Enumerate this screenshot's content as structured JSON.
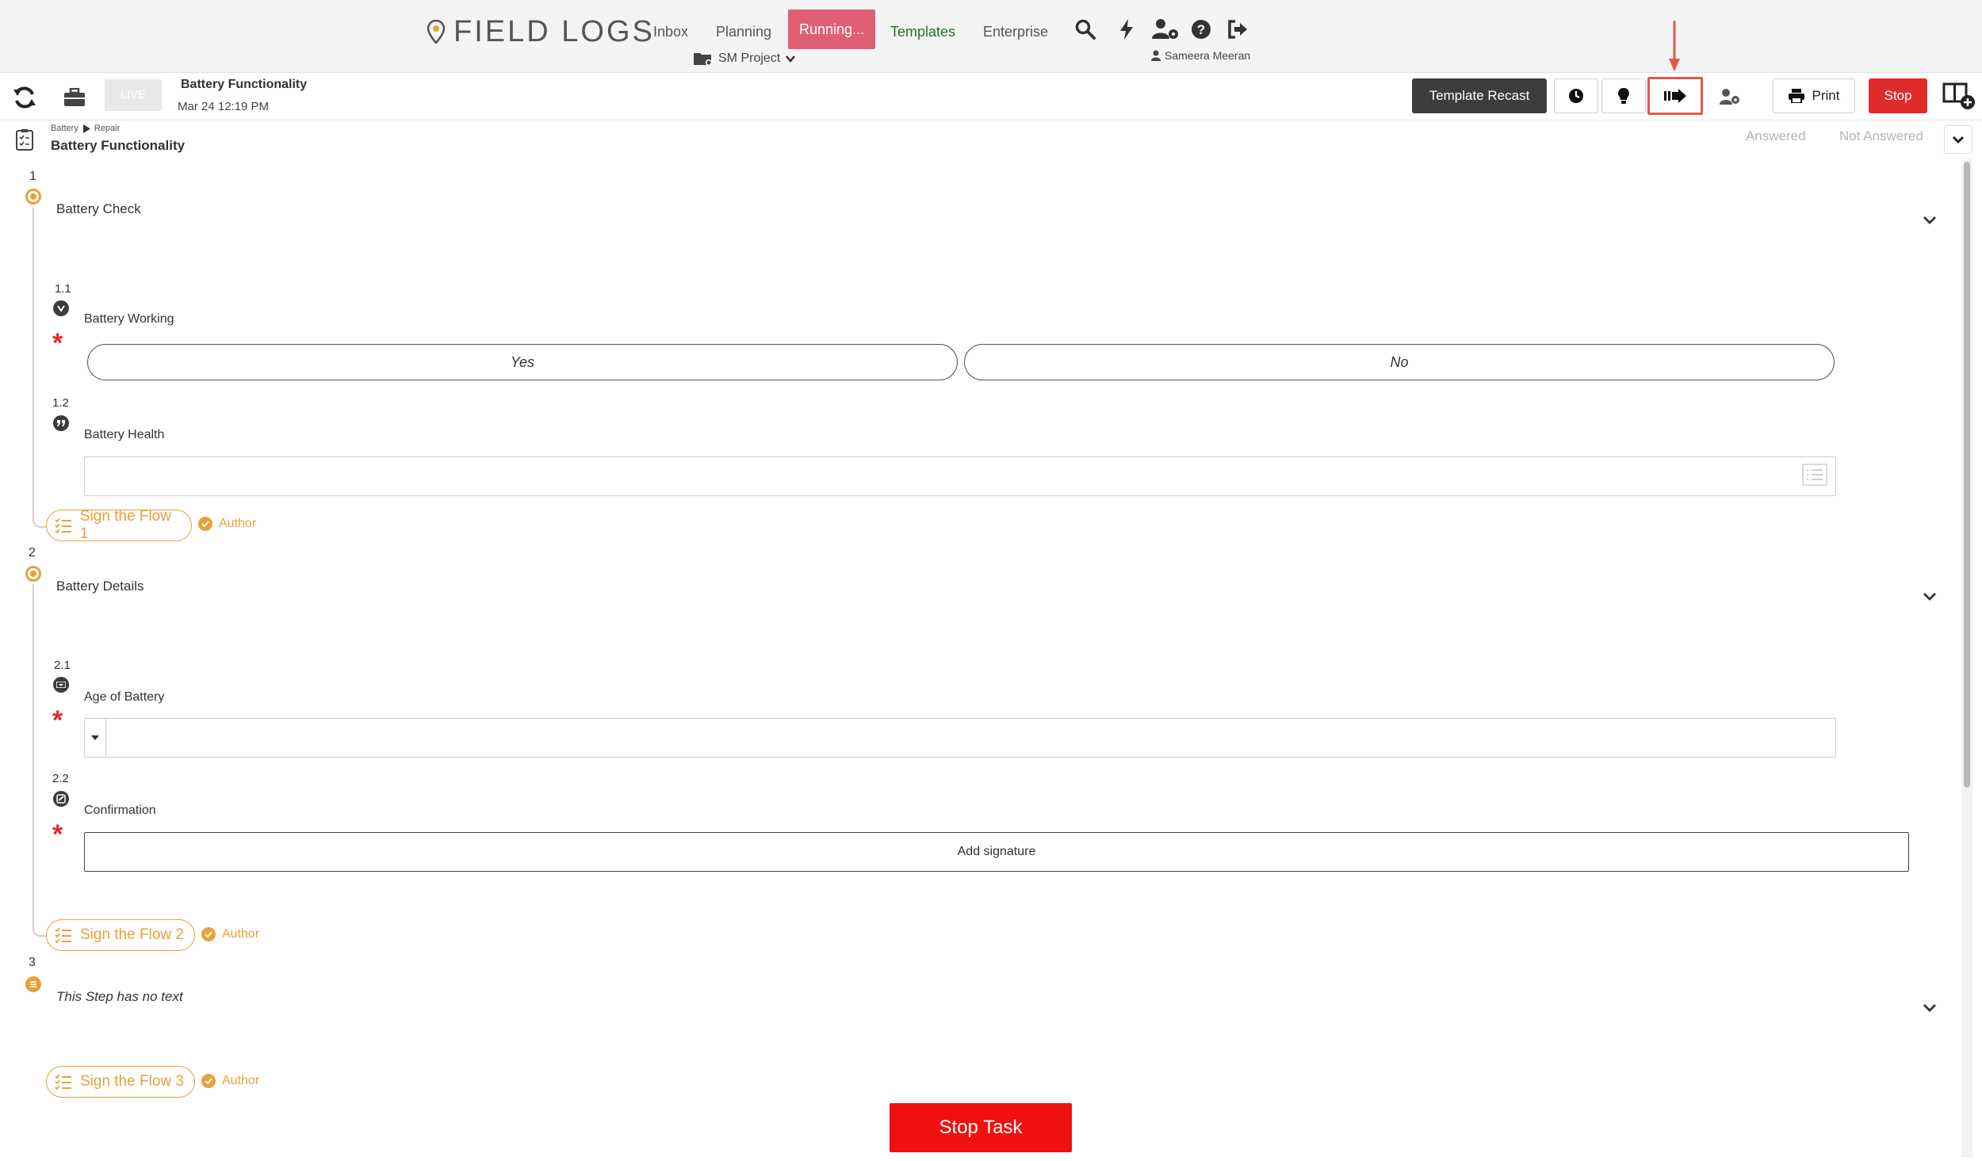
{
  "app": {
    "logo_text": "FIELD LOGS",
    "nav": [
      "Inbox",
      "Planning",
      "Running...",
      "Templates",
      "Enterprise"
    ],
    "project": "SM Project",
    "user": "Sameera Meeran",
    "colors": {
      "running": "#e05f75",
      "templates": "#2b6e2b",
      "accent": "#e8a13a",
      "stop": "#e02b2b"
    }
  },
  "toolbar": {
    "live": "LIVE",
    "title": "Battery Functionality",
    "date": "Mar 24 12:19 PM",
    "template_recast": "Template Recast",
    "print": "Print",
    "stop": "Stop"
  },
  "header": {
    "crumb_1": "Battery",
    "crumb_2": "Repair",
    "title": "Battery Functionality",
    "answered": "Answered",
    "not_answered": "Not Answered"
  },
  "steps": [
    {
      "num": "1",
      "title": "Battery Check",
      "sign": "Sign the Flow 1",
      "author": "Author",
      "questions": [
        {
          "num": "1.1",
          "label": "Battery Working",
          "yes": "Yes",
          "no": "No"
        },
        {
          "num": "1.2",
          "label": "Battery Health"
        }
      ]
    },
    {
      "num": "2",
      "title": "Battery Details",
      "sign": "Sign the Flow 2",
      "author": "Author",
      "questions": [
        {
          "num": "2.1",
          "label": "Age of Battery"
        },
        {
          "num": "2.2",
          "label": "Confirmation",
          "button": "Add signature"
        }
      ]
    },
    {
      "num": "3",
      "title": "This Step has no text",
      "sign": "Sign the Flow 3",
      "author": "Author"
    }
  ],
  "footer": {
    "stop_task": "Stop Task"
  }
}
